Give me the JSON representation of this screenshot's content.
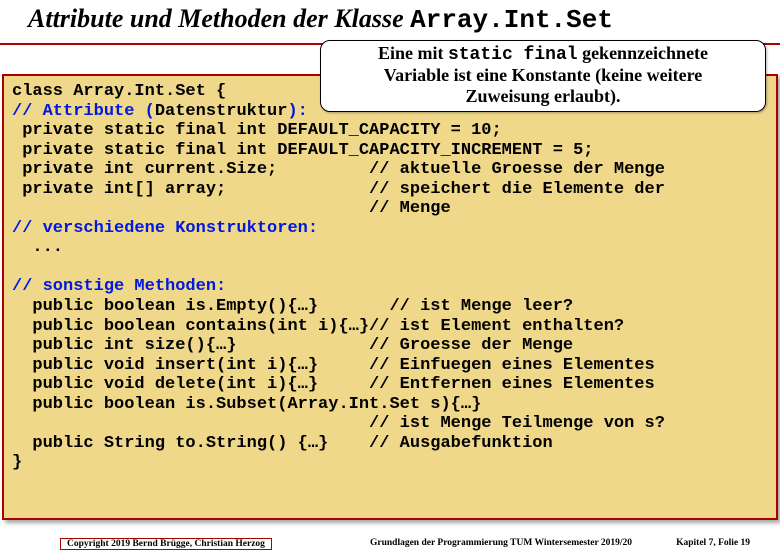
{
  "title": {
    "pre": "Attribute und Methoden der Klasse ",
    "mono": "Array.Int.Set"
  },
  "callout": {
    "l1a": "Eine mit ",
    "l1m": "static final",
    "l1b": " gekennzeichnete",
    "l2": "Variable ist eine Konstante (keine weitere",
    "l3": "Zuweisung erlaubt)."
  },
  "code": {
    "c00": "class Array.Int.Set {",
    "c01a": "// Attribute (",
    "c01b": "Datenstruktur",
    "c01c": "):",
    "c02": " private static final int DEFAULT_CAPACITY = 10;",
    "c03": " private static final int DEFAULT_CAPACITY_INCREMENT = 5;",
    "c04": " private int current.Size;         // aktuelle Groesse der Menge",
    "c05": " private int[] array;              // speichert die Elemente der",
    "c06": "                                   // Menge",
    "c07": "// verschiedene Konstruktoren:",
    "c08": "  ...",
    "c09": "",
    "c10": "// sonstige Methoden:",
    "c11": "  public boolean is.Empty(){…}       // ist Menge leer?",
    "c12": "  public boolean contains(int i){…}// ist Element enthalten?",
    "c13": "  public int size(){…}             // Groesse der Menge",
    "c14": "  public void insert(int i){…}     // Einfuegen eines Elementes",
    "c15": "  public void delete(int i){…}     // Entfernen eines Elementes",
    "c16": "  public boolean is.Subset(Array.Int.Set s){…}",
    "c17": "                                   // ist Menge Teilmenge von s?",
    "c18": "  public String to.String() {…}    // Ausgabefunktion",
    "c19": "}"
  },
  "footer": {
    "left": "Copyright 2019 Bernd Brügge, Christian Herzog",
    "center": "Grundlagen der Programmierung  TUM Wintersemester 2019/20",
    "right": "Kapitel 7, Folie 19"
  }
}
